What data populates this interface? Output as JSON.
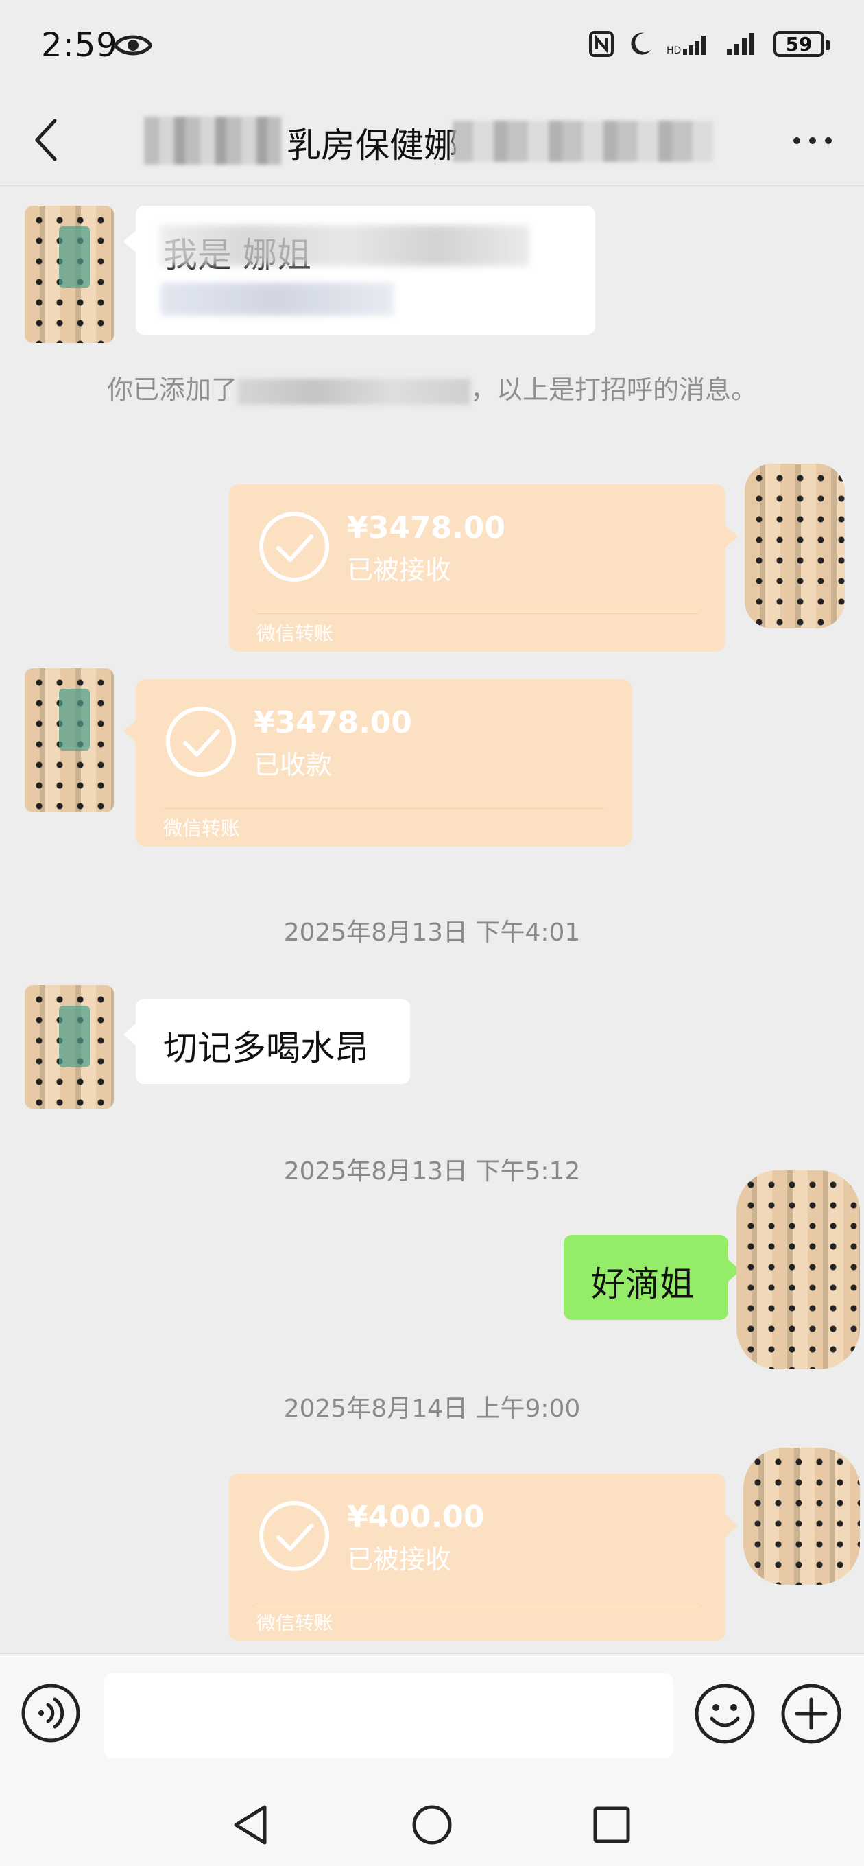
{
  "status_bar": {
    "time": "2:59",
    "battery": "59"
  },
  "header": {
    "title": "乳房保健娜"
  },
  "messages": {
    "intro_bubble_line1": "我是                     娜姐",
    "intro_bubble_line2": "",
    "system_text_prefix": "你已添加了",
    "system_text_suffix": "，以上是打招呼的消息。",
    "transfer_1": {
      "amount": "¥3478.00",
      "status": "已被接收",
      "label": "微信转账"
    },
    "transfer_2": {
      "amount": "¥3478.00",
      "status": "已收款",
      "label": "微信转账"
    },
    "time_1": "2025年8月13日 下午4:01",
    "text_left": "切记多喝水昂",
    "time_2": "2025年8月13日 下午5:12",
    "text_right": "好滴姐",
    "time_3": "2025年8月14日 上午9:00",
    "transfer_3": {
      "amount": "¥400.00",
      "status": "已被接收",
      "label": "微信转账"
    }
  },
  "input": {
    "placeholder": ""
  },
  "icons": {
    "eye": "eye-icon",
    "nfc": "nfc-icon",
    "moon": "moon-icon",
    "signal": "signal-icon",
    "back": "back-arrow-icon",
    "more": "more-icon",
    "check": "check-circle-icon",
    "voice": "voice-icon",
    "emoji": "emoji-icon",
    "plus": "plus-icon"
  }
}
